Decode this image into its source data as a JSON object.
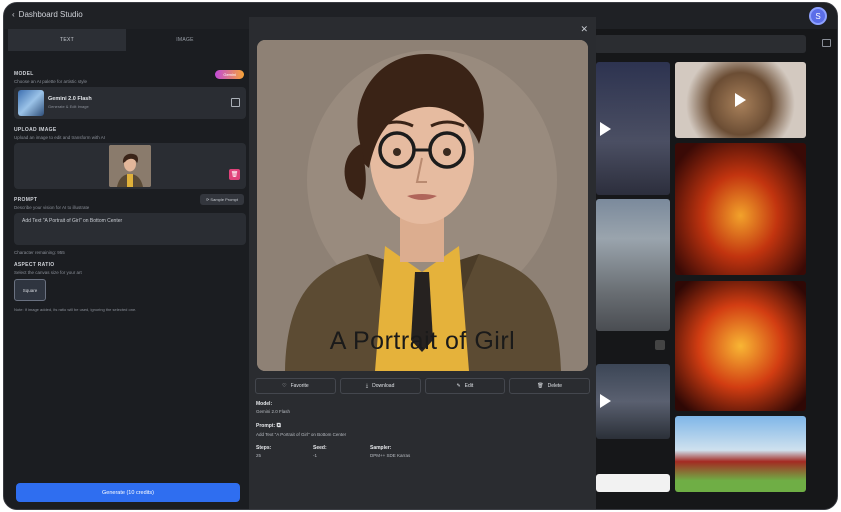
{
  "header": {
    "back_label": "Dashboard Studio",
    "avatar_letter": "S"
  },
  "tabs": [
    {
      "label": "TEXT"
    },
    {
      "label": "IMAGE"
    }
  ],
  "model": {
    "label": "MODEL",
    "hint": "Choose an AI palette for artistic style",
    "badge": "Gemini",
    "name": "Gemini 2.0 Flash",
    "sub": "Generate & Edit Image"
  },
  "upload": {
    "label": "UPLOAD IMAGE",
    "hint": "Upload an image to edit and transform with AI"
  },
  "prompt": {
    "label": "PROMPT",
    "hint": "Describe your vision for AI to illustrate",
    "sample_label": "Sample Prompt",
    "value": "Add Text \"A Portrait of Girl\" on Bottom Center",
    "char_label": "Character remaining: 955"
  },
  "aspect": {
    "label": "ASPECT RATIO",
    "hint": "Select the canvas size for your art",
    "selected": "Square",
    "note": "Note: If image added, its ratio will be used, ignoring the selected one."
  },
  "generate_label": "Generate (10 credits)",
  "modal": {
    "caption": "A Portrait of Girl",
    "actions": {
      "favorite": "Favorite",
      "download": "Download",
      "edit": "Edit",
      "delete": "Delete"
    },
    "model_key": "Model:",
    "model_value": "Gemini 2.0 Flash",
    "prompt_key": "Prompt:",
    "prompt_value": "Add Text \"A Portrait of Girl\" on Bottom Center",
    "steps_key": "Steps:",
    "steps_value": "25",
    "seed_key": "Seed:",
    "seed_value": "-1",
    "sampler_key": "Sampler:",
    "sampler_value": "DPM++ SDE Karras"
  },
  "colors": {
    "accent": "#2f6ef0",
    "delete": "#e0427a",
    "badge_start": "#c24ad8",
    "badge_end": "#f7a437"
  }
}
